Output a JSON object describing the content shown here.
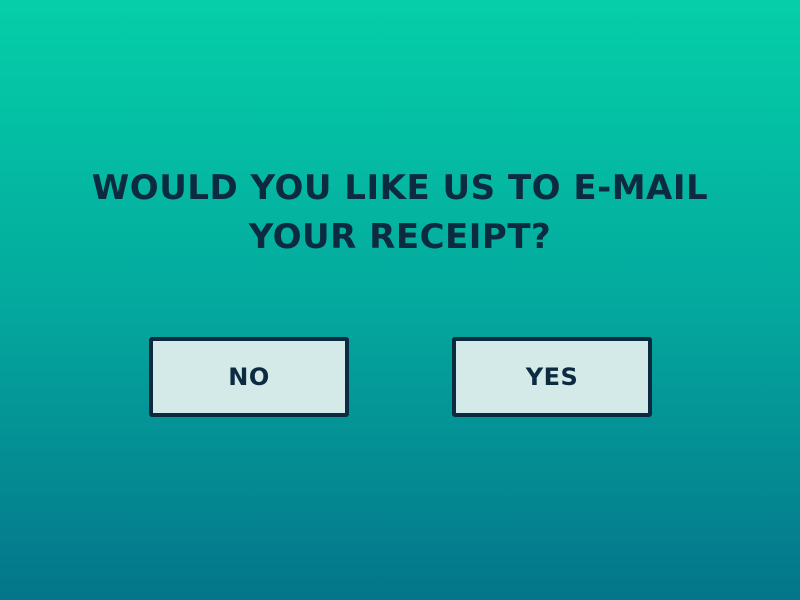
{
  "dialog": {
    "prompt_line1": "WOULD YOU LIKE US TO E-MAIL",
    "prompt_line2": "YOUR RECEIPT?",
    "no_label": "NO",
    "yes_label": "YES"
  },
  "colors": {
    "background_top": "#05cfa8",
    "background_bottom": "#04758a",
    "text": "#0c2a40",
    "button_fill": "#d3eae9",
    "button_border": "#0c2a40"
  }
}
